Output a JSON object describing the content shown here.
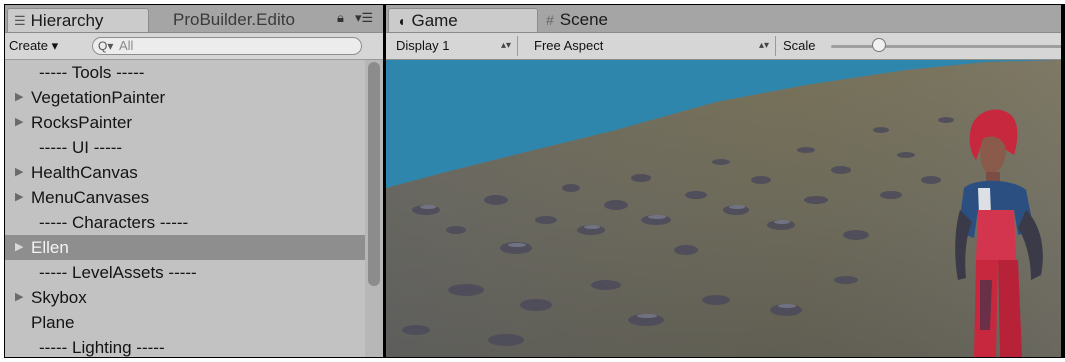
{
  "hierarchy_panel": {
    "tabs": [
      {
        "label": "Hierarchy",
        "icon": "list-icon",
        "active": true
      },
      {
        "label": "ProBuilder.Edito",
        "active": false
      }
    ],
    "lock_icon": "lock-icon",
    "menu_icon": "panel-menu-icon",
    "toolbar": {
      "create_label": "Create ▾",
      "search_prefix": "Q▾",
      "search_placeholder": "All"
    },
    "items": [
      {
        "label": "----- Tools -----",
        "arrow": false,
        "separator": true
      },
      {
        "label": "VegetationPainter",
        "arrow": true
      },
      {
        "label": "RocksPainter",
        "arrow": true
      },
      {
        "label": "----- UI -----",
        "arrow": false,
        "separator": true
      },
      {
        "label": "HealthCanvas",
        "arrow": true
      },
      {
        "label": "MenuCanvases",
        "arrow": true
      },
      {
        "label": "----- Characters -----",
        "arrow": false,
        "separator": true
      },
      {
        "label": "Ellen",
        "arrow": true,
        "selected": true
      },
      {
        "label": "----- LevelAssets -----",
        "arrow": false,
        "separator": true
      },
      {
        "label": "Skybox",
        "arrow": true
      },
      {
        "label": "Plane",
        "arrow": false
      },
      {
        "label": "----- Lighting -----",
        "arrow": false,
        "separator": true
      }
    ]
  },
  "game_panel": {
    "tabs": [
      {
        "label": "Game",
        "icon": "game-controller-icon",
        "active": true
      },
      {
        "label": "Scene",
        "icon": "grid-hash-icon",
        "active": false
      }
    ],
    "toolbar": {
      "display": "Display 1",
      "aspect": "Free Aspect",
      "scale_label": "Scale",
      "scale_value": 0.2
    }
  },
  "colors": {
    "sky": "#2f86ad",
    "terrain": "#6b6a58",
    "selection": "#8e8e8e",
    "character_red": "#c8283e"
  }
}
